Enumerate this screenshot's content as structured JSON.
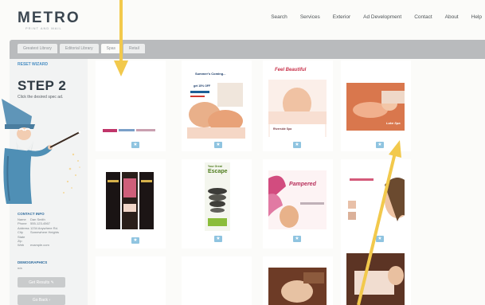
{
  "header": {
    "logo": "METRO",
    "logo_tagline": "PRINT AND MAIL",
    "nav": [
      "Search",
      "Services",
      "Exterior",
      "Ad Development",
      "Contact",
      "About",
      "Help"
    ]
  },
  "tabs": [
    {
      "label": "Greatest Library",
      "active": false
    },
    {
      "label": "Editorial Library",
      "active": false
    },
    {
      "label": "Spas",
      "active": true
    },
    {
      "label": "Retail",
      "active": false
    }
  ],
  "sidebar": {
    "restart_label": "RESET WIZARD",
    "step_title": "STEP 2",
    "step_desc": "Click the desired spec ad.",
    "contact_heading": "CONTACT INFO",
    "contact_rows": [
      {
        "key": "Name",
        "value": "Dan Smith"
      },
      {
        "key": "Phone",
        "value": "555-123-4567"
      },
      {
        "key": "Address",
        "value": "1234 Anywhere Rd."
      },
      {
        "key": "City",
        "value": "Somewhere Heights"
      },
      {
        "key": "State",
        "value": ""
      },
      {
        "key": "Zip",
        "value": ""
      },
      {
        "key": "Web",
        "value": "example.com"
      }
    ],
    "details_heading": "DEMOGRAPHICS",
    "details_value": "n/a",
    "button_1": "Get Results",
    "button_2": "Go Back"
  },
  "ads": [
    {
      "title": "",
      "subtitle": ""
    },
    {
      "title": "Summer's Coming...",
      "subtitle": "get 15% OFF"
    },
    {
      "title": "Feel Beautiful",
      "subtitle": "Riverside Spa"
    },
    {
      "title": "",
      "subtitle": "Lake Spa"
    },
    {
      "title": "",
      "subtitle": ""
    },
    {
      "title": "Escape",
      "subtitle": "Your Great"
    },
    {
      "title": "Pampered",
      "subtitle": ""
    },
    {
      "title": "",
      "subtitle": ""
    },
    {
      "title": "",
      "subtitle": ""
    },
    {
      "title": "",
      "subtitle": ""
    },
    {
      "title": "",
      "subtitle": ""
    },
    {
      "title": "",
      "subtitle": ""
    }
  ],
  "colors": {
    "accent": "#4a8fc4",
    "arrow": "#f2c94c",
    "tab_bar": "#b9bbbd",
    "star": "#8fc4e0"
  },
  "icons": [
    "wizard-illustration",
    "star-icon",
    "pencil-icon",
    "arrow-icon"
  ]
}
